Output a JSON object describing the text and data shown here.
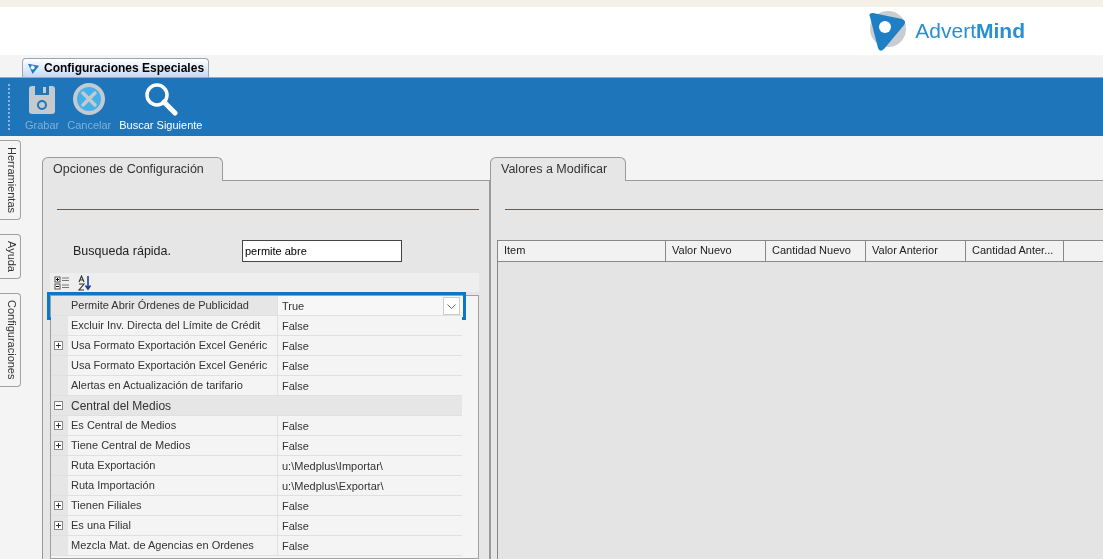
{
  "logo": {
    "text": "Advert**Mind**"
  },
  "document_tab": {
    "label": "Configuraciones Especiales",
    "selected": true
  },
  "toolbar": [
    {
      "kind": "save",
      "label": "Grabar",
      "disabled": true
    },
    {
      "kind": "cancel",
      "label": "Cancelar",
      "disabled": true
    },
    {
      "kind": "search",
      "label": "Buscar Siguiente",
      "disabled": false
    }
  ],
  "side_tabs": [
    {
      "label": "Herramientas"
    },
    {
      "label": "Ayuda"
    },
    {
      "label": "Configuraciones"
    }
  ],
  "left_panel": {
    "title": "Opciones de Configuración",
    "search_label": "Busqueda rápida.",
    "search_value": "permite abre",
    "rows": [
      {
        "kind": "property",
        "name": "Permite Abrir Órdenes de Publicidad",
        "value": "True",
        "expandable": false,
        "selected": true
      },
      {
        "kind": "property",
        "name": "Excluir Inv. Directa del Límite de Crédit",
        "value": "False",
        "expandable": false,
        "selected": false
      },
      {
        "kind": "property",
        "name": "Usa Formato Exportación Excel Genéric",
        "value": "False",
        "expandable": true,
        "selected": false
      },
      {
        "kind": "property",
        "name": "Usa Formato Exportación Excel Genéric",
        "value": "False",
        "expandable": false,
        "selected": false
      },
      {
        "kind": "property",
        "name": "Alertas en Actualización de tarifario",
        "value": "False",
        "expandable": false,
        "selected": false
      },
      {
        "kind": "category",
        "name": "Central del Medios",
        "expanded": true
      },
      {
        "kind": "property",
        "name": "Es Central de Medios",
        "value": "False",
        "expandable": true,
        "selected": false
      },
      {
        "kind": "property",
        "name": "Tiene Central de Medios",
        "value": "False",
        "expandable": true,
        "selected": false
      },
      {
        "kind": "property",
        "name": "Ruta Exportación",
        "value": "u:\\Medplus\\Importar\\",
        "expandable": false,
        "selected": false
      },
      {
        "kind": "property",
        "name": "Ruta Importación",
        "value": "u:\\Medplus\\Exportar\\",
        "expandable": false,
        "selected": false
      },
      {
        "kind": "property",
        "name": "Tienen Filiales",
        "value": "False",
        "expandable": true,
        "selected": false
      },
      {
        "kind": "property",
        "name": "Es una Filial",
        "value": "False",
        "expandable": true,
        "selected": false
      },
      {
        "kind": "property",
        "name": "Mezcla Mat. de Agencias en Ordenes",
        "value": "False",
        "expandable": false,
        "selected": false
      }
    ]
  },
  "right_panel": {
    "title": "Valores a Modificar",
    "columns": [
      "Item",
      "Valor Nuevo",
      "Cantidad Nuevo",
      "Valor Anterior",
      "Cantidad Anter..."
    ]
  }
}
